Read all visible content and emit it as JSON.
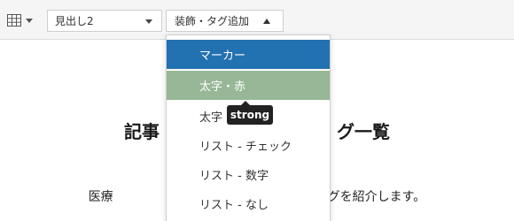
{
  "toolbar": {
    "table_icon": "table-grid-icon",
    "heading_select": {
      "value": "見出し2"
    },
    "decoration_select": {
      "value": "装飾・タグ追加"
    }
  },
  "dropdown": {
    "items": [
      {
        "label": "マーカー",
        "state": "selected"
      },
      {
        "label": "太字・赤",
        "state": "hover"
      },
      {
        "label": "太字"
      },
      {
        "label": "リスト - チェック"
      },
      {
        "label": "リスト - 数字"
      },
      {
        "label": "リスト - なし"
      }
    ]
  },
  "tooltip": {
    "text": "strong"
  },
  "article": {
    "title_left": "記事",
    "title_right": "グ一覧",
    "body_left": "医療",
    "body_right": "る装飾タグを紹介します。"
  },
  "colors": {
    "selected_bg": "#2271b1",
    "hover_bg": "#97b797",
    "tooltip_bg": "#222222"
  }
}
